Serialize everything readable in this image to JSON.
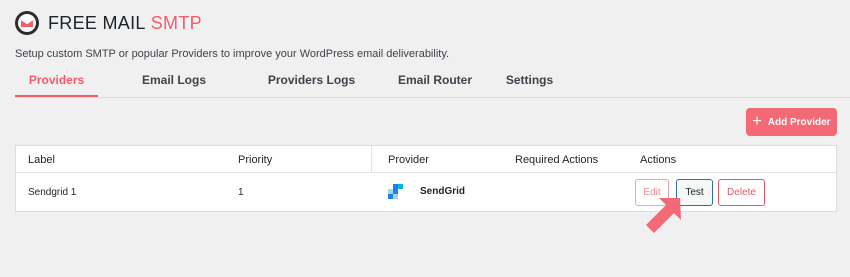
{
  "app": {
    "title_main": "FREE MAIL",
    "title_accent": "SMTP",
    "subtitle": "Setup custom SMTP or popular Providers to improve your WordPress email deliverability."
  },
  "tabs": [
    {
      "label": "Providers",
      "active": true
    },
    {
      "label": "Email Logs",
      "active": false
    },
    {
      "label": "Providers Logs",
      "active": false
    },
    {
      "label": "Email Router",
      "active": false
    },
    {
      "label": "Settings",
      "active": false
    }
  ],
  "toolbar": {
    "add_provider_label": "Add Provider",
    "add_icon": "plus-icon"
  },
  "table": {
    "columns": [
      "Label",
      "Priority",
      "Provider",
      "Required Actions",
      "Actions"
    ],
    "rows": [
      {
        "label": "Sendgrid 1",
        "priority": "1",
        "provider": "SendGrid",
        "provider_icon": "sendgrid-icon",
        "required_actions": "",
        "actions": {
          "edit": "Edit",
          "test": "Test",
          "delete": "Delete"
        }
      }
    ]
  },
  "colors": {
    "accent": "#f45c6a",
    "button_primary": "#f36a76",
    "test_border": "#3b6e9e",
    "sendgrid_blue": "#1a82e2"
  }
}
